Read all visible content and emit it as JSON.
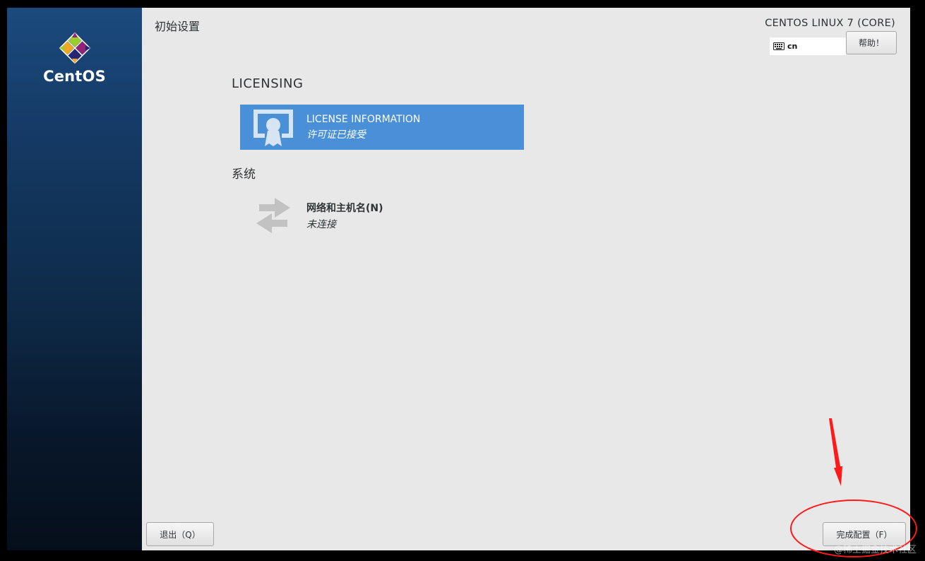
{
  "sidebar": {
    "brand_name": "CentOS"
  },
  "header": {
    "page_title": "初始设置",
    "product_name": "CENTOS LINUX 7 (CORE)",
    "keyboard_layout": "cn",
    "help_label": "帮助！"
  },
  "sections": {
    "licensing": {
      "heading": "LICENSING",
      "spoke": {
        "title": "LICENSE INFORMATION",
        "status": "许可证已接受",
        "icon": "license-certificate-icon"
      }
    },
    "system": {
      "heading": "系统",
      "spoke": {
        "title": "网络和主机名(N)",
        "status": "未连接",
        "icon": "network-arrows-icon"
      }
    }
  },
  "footer": {
    "quit_label": "退出（Q）",
    "finish_label": "完成配置（F）"
  },
  "watermark": "@稀土掘金技术社区",
  "colors": {
    "selected_spoke": "#4a90d9",
    "annotation": "#ff1a1a",
    "sidebar_top": "#1b4a7e"
  }
}
